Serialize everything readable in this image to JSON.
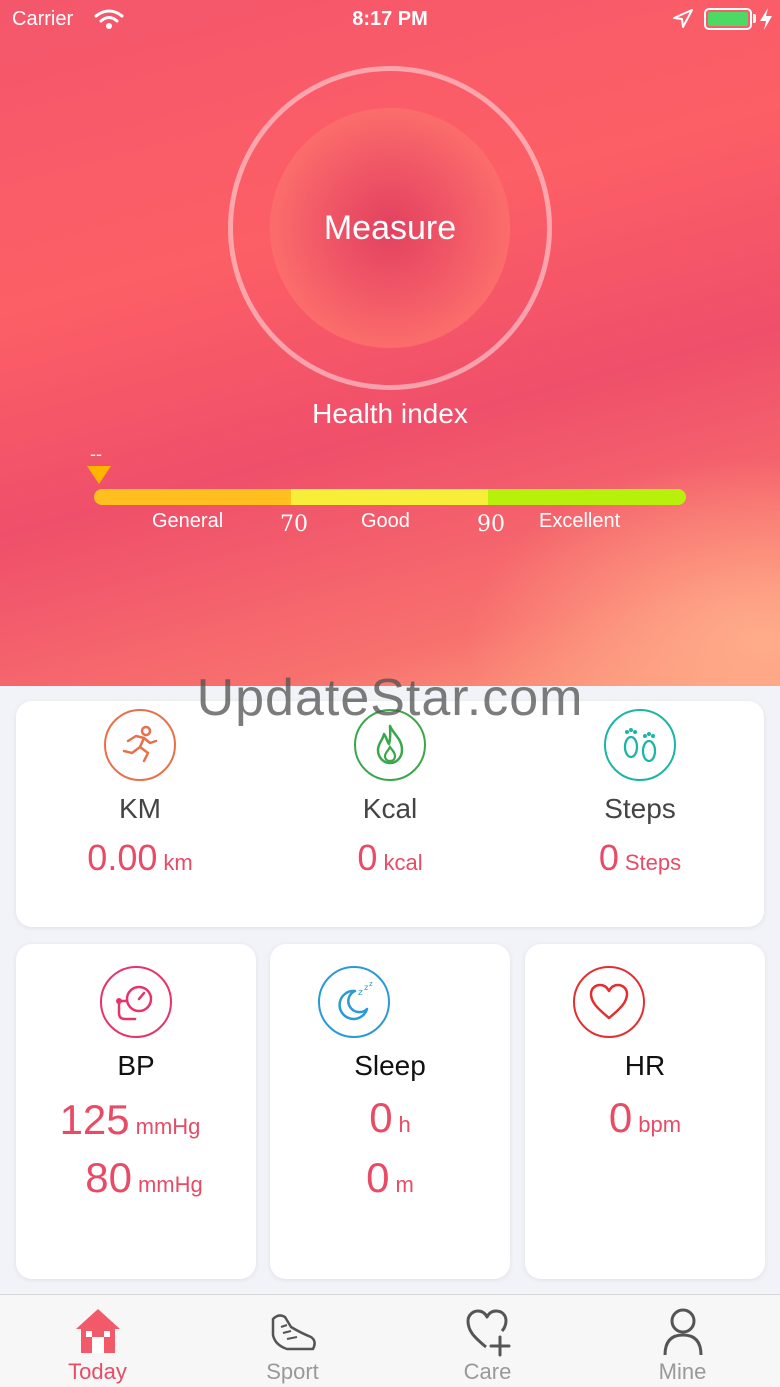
{
  "status_bar": {
    "carrier": "Carrier",
    "time": "8:17 PM"
  },
  "hero": {
    "measure_label": "Measure",
    "health_title": "Health index",
    "current_index": "--",
    "scale": {
      "general": "General",
      "threshold_1": "70",
      "good": "Good",
      "threshold_2": "90",
      "excellent": "Excellent"
    }
  },
  "watermark": "UpdateStar.com",
  "activity": {
    "km": {
      "label": "KM",
      "value": "0.00",
      "unit": "km"
    },
    "kcal": {
      "label": "Kcal",
      "value": "0",
      "unit": "kcal"
    },
    "steps": {
      "label": "Steps",
      "value": "0",
      "unit": "Steps"
    }
  },
  "bp": {
    "label": "BP",
    "systolic": "125",
    "systolic_unit": "mmHg",
    "diastolic": "80",
    "diastolic_unit": "mmHg"
  },
  "sleep": {
    "label": "Sleep",
    "hours": "0",
    "hours_unit": "h",
    "minutes": "0",
    "minutes_unit": "m"
  },
  "hr": {
    "label": "HR",
    "value": "0",
    "unit": "bpm"
  },
  "tabs": [
    {
      "label": "Today",
      "icon": "home-icon"
    },
    {
      "label": "Sport",
      "icon": "shoe-icon"
    },
    {
      "label": "Care",
      "icon": "heart-plus-icon"
    },
    {
      "label": "Mine",
      "icon": "person-icon"
    }
  ],
  "colors": {
    "accent": "#e84b66",
    "km_icon": "#e8704a",
    "kcal_icon": "#3aa74b",
    "steps_icon": "#1bb5a6",
    "bp_icon": "#e8326a",
    "sleep_icon": "#2a9ad6",
    "hr_icon": "#e23030"
  }
}
